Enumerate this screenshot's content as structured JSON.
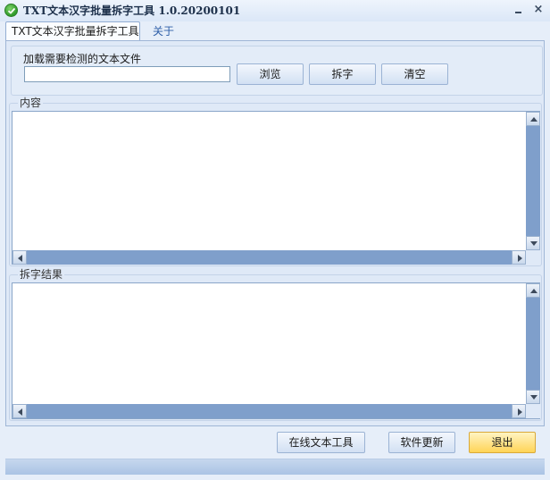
{
  "window": {
    "title": "TXT文本汉字批量拆字工具 1.0.20200101",
    "icon": "green-check-icon",
    "minimize_icon": "minimize-icon",
    "close_glyph": "×"
  },
  "tabs": [
    {
      "label": "TXT文本汉字批量拆字工具",
      "selected": true
    },
    {
      "label": "关于",
      "selected": false
    }
  ],
  "file_section": {
    "label": "加载需要检测的文本文件",
    "input_value": "",
    "browse_label": "浏览",
    "split_label": "拆字",
    "clear_label": "清空"
  },
  "content_section": {
    "caption": "内容",
    "text": ""
  },
  "result_section": {
    "caption": "拆字结果",
    "text": ""
  },
  "footer": {
    "online_tools_label": "在线文本工具",
    "update_label": "软件更新",
    "exit_label": "退出"
  },
  "colors": {
    "window_bg": "#e6eef9",
    "scrollbar_track": "#7f9fcb",
    "exit_button": "#ffd457"
  }
}
